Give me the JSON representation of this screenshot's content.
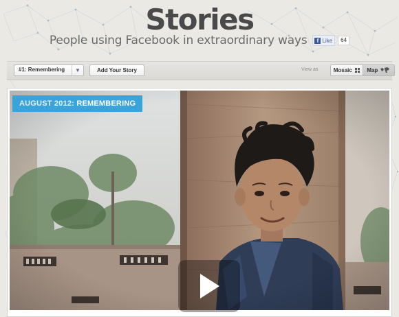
{
  "header": {
    "title": "Stories",
    "subtitle": "People using Facebook in extraordinary ways",
    "like": {
      "label": "Like",
      "count": "64",
      "fb_letter": "f"
    }
  },
  "toolbar": {
    "story_select": {
      "selected": "#1: Remembering",
      "caret": "▼"
    },
    "add_story_label": "Add Your Story",
    "view_as_label": "View as",
    "views": [
      {
        "label": "Mosaic",
        "icon": "mosaic-icon",
        "active": false
      },
      {
        "label": "Map",
        "icon": "map-icon",
        "active": true
      }
    ]
  },
  "story": {
    "badge_date": "AUGUST 2012:",
    "badge_title": "REMEMBERING",
    "play_icon": "play-icon"
  },
  "colors": {
    "badge": "#3ba3db",
    "title": "#4a4a4a",
    "facebook": "#3b5998"
  }
}
